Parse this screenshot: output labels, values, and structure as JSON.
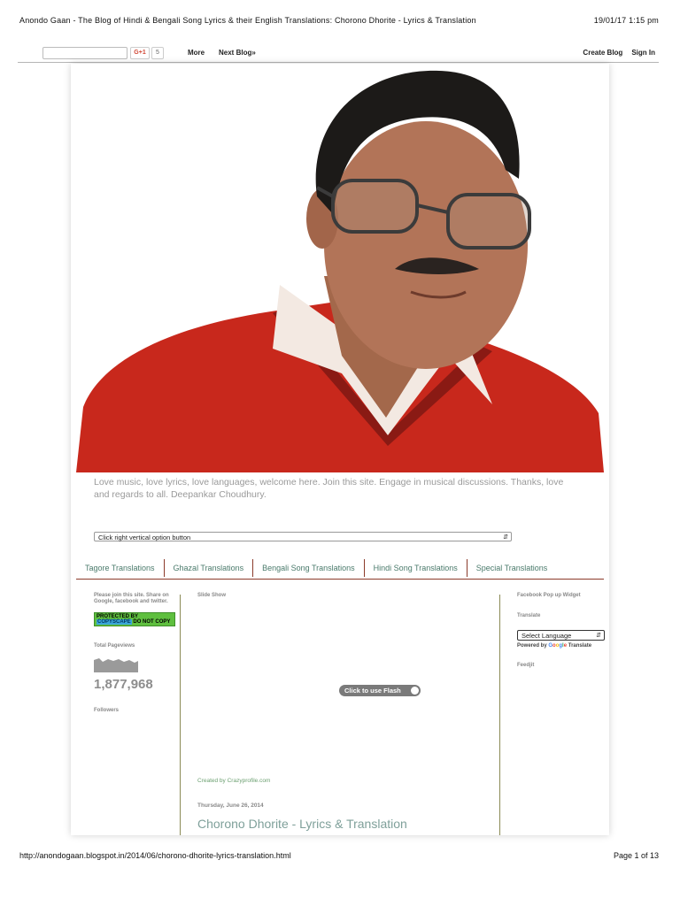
{
  "print": {
    "title": "Anondo Gaan - The Blog of Hindi & Bengali Song Lyrics & their English Translations: Chorono Dhorite - Lyrics & Translation",
    "datetime": "19/01/17 1:15 pm",
    "url": "http://anondogaan.blogspot.in/2014/06/chorono-dhorite-lyrics-translation.html",
    "page": "Page 1 of 13"
  },
  "navbar": {
    "gplus_label": "G+1",
    "gplus_count": "5",
    "more": "More",
    "next_blog": "Next Blog»",
    "create_blog": "Create Blog",
    "sign_in": "Sign In"
  },
  "blog": {
    "description": "Love music, love lyrics, love languages, welcome here. Join this site. Engage in musical discussions. Thanks, love and regards to all. Deepankar Choudhury.",
    "select_label": "Click right vertical option button"
  },
  "tabs": [
    {
      "label": "Tagore Translations"
    },
    {
      "label": "Ghazal Translations"
    },
    {
      "label": "Bengali Song Translations"
    },
    {
      "label": "Hindi Song Translations"
    },
    {
      "label": "Special Translations"
    }
  ],
  "left": {
    "join_text": "Please join this site. Share on Google, facebook and twitter.",
    "copyscape_pre": "PROTECTED BY",
    "copyscape_brand": "COPYSCAPE",
    "copyscape_post": "DO NOT COPY",
    "pageviews_head": "Total Pageviews",
    "pageviews_count": "1,877,968",
    "followers_head": "Followers"
  },
  "middle": {
    "slideshow_head": "Slide Show",
    "flash_button": "Click to use Flash",
    "created_by": "Created by Crazyprofile.com",
    "post_date": "Thursday, June 26, 2014",
    "post_title": "Chorono Dhorite - Lyrics & Translation"
  },
  "right": {
    "fb_head": "Facebook Pop up Widget",
    "translate_head": "Translate",
    "language_select": "Select Language",
    "powered_by": "Powered by",
    "translate_word": "Translate",
    "feedjit_head": "Feedjit"
  },
  "colors": {
    "tab_text": "#4a7a6b",
    "tab_border": "#8b3a2a",
    "desc_text": "#9a9a9a",
    "sweater": "#c8281c"
  }
}
